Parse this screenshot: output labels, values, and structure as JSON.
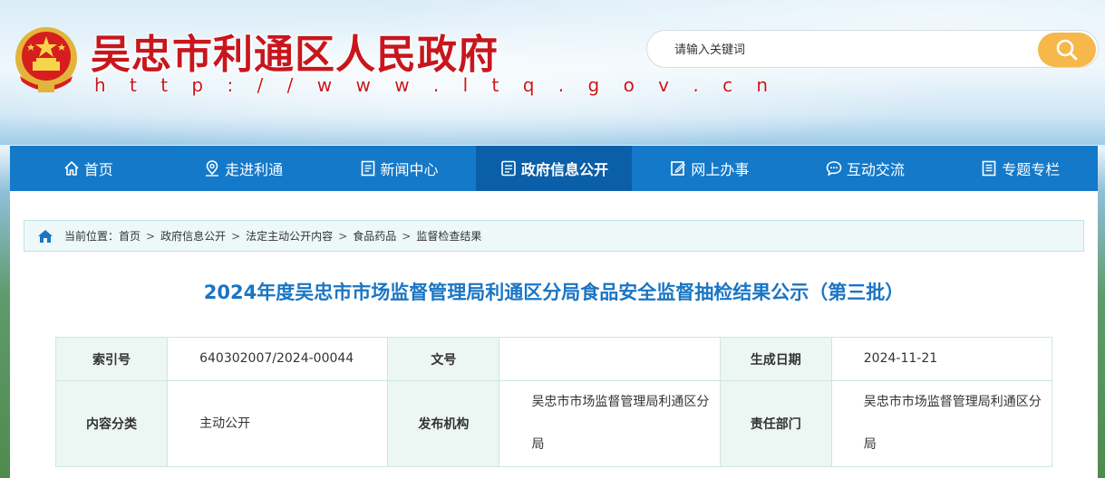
{
  "header": {
    "site_title": "吴忠市利通区人民政府",
    "site_url": "h t t p : / / w w w . l t q . g o v . c n",
    "search": {
      "placeholder": "请输入关键词",
      "value": ""
    }
  },
  "nav": {
    "items": [
      {
        "label": "首页",
        "icon": "home-icon"
      },
      {
        "label": "走进利通",
        "icon": "map-pin-icon"
      },
      {
        "label": "新闻中心",
        "icon": "document-icon"
      },
      {
        "label": "政府信息公开",
        "icon": "list-icon",
        "active": true
      },
      {
        "label": "网上办事",
        "icon": "edit-icon"
      },
      {
        "label": "互动交流",
        "icon": "chat-icon"
      },
      {
        "label": "专题专栏",
        "icon": "topic-icon"
      }
    ]
  },
  "breadcrumb": {
    "prefix": "当前位置：",
    "items": [
      "首页",
      "政府信息公开",
      "法定主动公开内容",
      "食品药品",
      "监督检查结果"
    ],
    "separator": ">"
  },
  "article": {
    "title": "2024年度吴忠市市场监督管理局利通区分局食品安全监督抽检结果公示（第三批）"
  },
  "meta": {
    "index_no_label": "索引号",
    "index_no": "640302007/2024-00044",
    "doc_no_label": "文号",
    "doc_no": "",
    "date_label": "生成日期",
    "date": "2024-11-21",
    "category_label": "内容分类",
    "category": "主动公开",
    "publisher_label": "发布机构",
    "publisher": "吴忠市市场监督管理局利通区分局",
    "dept_label": "责任部门",
    "dept": "吴忠市市场监督管理局利通区分局"
  },
  "colors": {
    "nav_bg": "#1479c9",
    "nav_active": "#0b5fa8",
    "title_red": "#c8161d",
    "article_title_blue": "#1a75c4",
    "search_btn": "#f6b84a"
  }
}
